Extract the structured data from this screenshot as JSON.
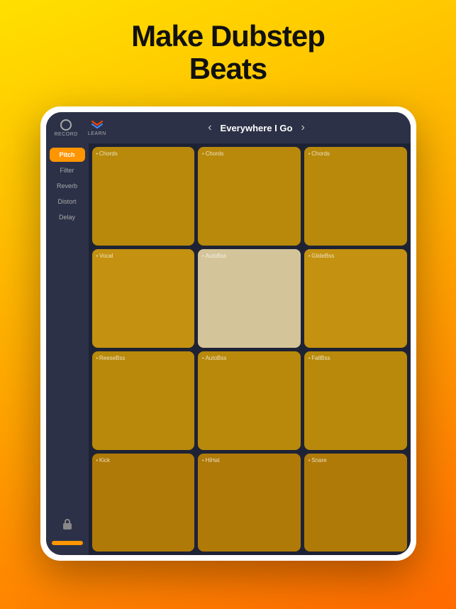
{
  "headline": {
    "line1": "Make Dubstep",
    "line2": "Beats"
  },
  "topbar": {
    "record_label": "RECORD",
    "learn_label": "LEARN",
    "song_title": "Everywhere I Go",
    "prev_arrow": "‹",
    "next_arrow": "›"
  },
  "sidebar": {
    "items": [
      {
        "label": "Pitch",
        "active": true
      },
      {
        "label": "Filter",
        "active": false
      },
      {
        "label": "Reverb",
        "active": false
      },
      {
        "label": "Distort",
        "active": false
      },
      {
        "label": "Delay",
        "active": false
      }
    ],
    "lock_label": "lock"
  },
  "pads": [
    {
      "row": 1,
      "label": "Chords",
      "style": "row1"
    },
    {
      "row": 1,
      "label": "Chords",
      "style": "row1"
    },
    {
      "row": 1,
      "label": "Chords",
      "style": "row1"
    },
    {
      "row": 2,
      "label": "Vocal",
      "style": "row2-left"
    },
    {
      "row": 2,
      "label": "AutoBss",
      "style": "row2-mid"
    },
    {
      "row": 2,
      "label": "GlideBss",
      "style": "row2-right"
    },
    {
      "row": 3,
      "label": "ReeseBss",
      "style": "row3"
    },
    {
      "row": 3,
      "label": "AutoBss",
      "style": "row3"
    },
    {
      "row": 3,
      "label": "FallBss",
      "style": "row3"
    },
    {
      "row": 4,
      "label": "Kick",
      "style": "row4"
    },
    {
      "row": 4,
      "label": "HiHat",
      "style": "row4"
    },
    {
      "row": 4,
      "label": "Snare",
      "style": "row4"
    }
  ]
}
